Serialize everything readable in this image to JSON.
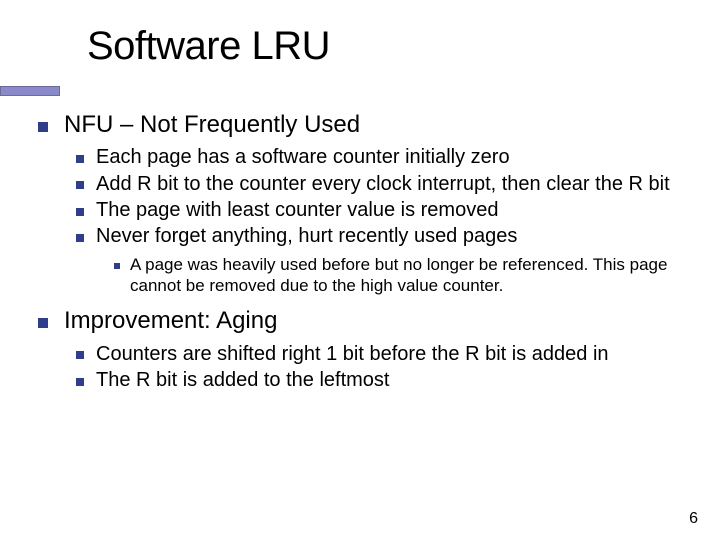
{
  "title": "Software LRU",
  "section1": {
    "heading": "NFU – Not Frequently Used",
    "items": [
      "Each page has a software counter initially zero",
      "Add R bit to the counter every clock interrupt, then clear the R bit",
      "The page with least counter value is removed",
      "Never forget anything, hurt recently used pages"
    ],
    "subnote": "A page was heavily used before but no longer be referenced. This page cannot be removed due to the high value counter."
  },
  "section2": {
    "heading": "Improvement: Aging",
    "items": [
      "Counters are shifted right 1 bit before the R bit is added in",
      "The R bit is added to the leftmost"
    ]
  },
  "page_number": "6"
}
